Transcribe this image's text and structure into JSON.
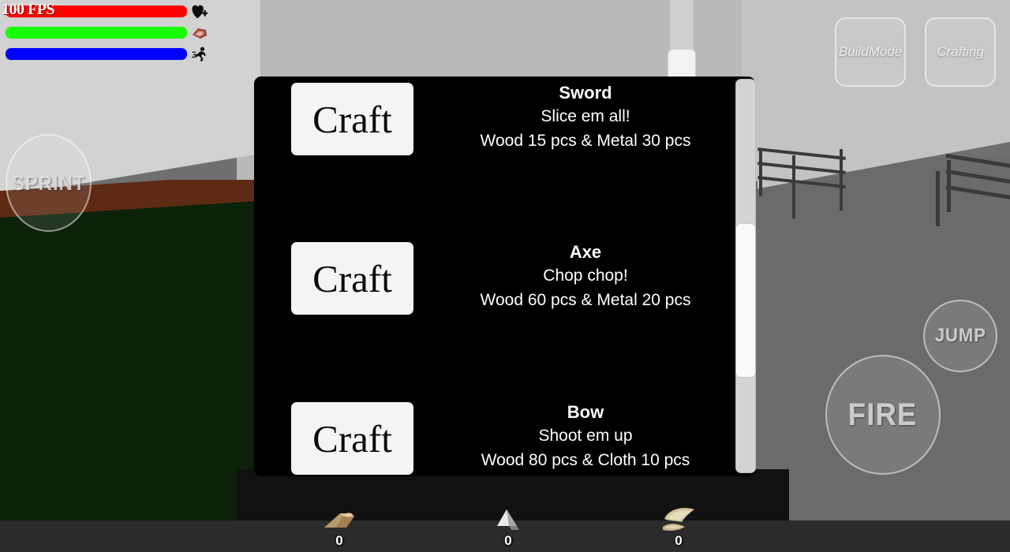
{
  "hud": {
    "fps_label": "100 FPS",
    "bars": [
      {
        "name": "health",
        "icon": "heart-plus-icon",
        "glyph": "♥",
        "color": "#ff0000",
        "fill_percent": 100,
        "track_color": "#c9c9c9"
      },
      {
        "name": "hunger",
        "icon": "meat-icon",
        "glyph": "🥩",
        "color": "#1aff00",
        "fill_percent": 100,
        "track_color": "#c9c9c9"
      },
      {
        "name": "stamina",
        "icon": "running-man-icon",
        "glyph": "🏃",
        "color": "#0000ff",
        "fill_percent": 100,
        "track_color": "#c9c9c9"
      }
    ]
  },
  "controls": {
    "sprint_label": "SPRINT",
    "fire_label": "FIRE",
    "jump_label": "JUMP",
    "buildmode_label": "BuildMode",
    "crafting_label": "Crafting"
  },
  "crafting_panel": {
    "background_color": "#000000",
    "recipes": [
      {
        "button_label": "Craft",
        "name": "Sword",
        "description": "Slice em all!",
        "cost": "Wood 15 pcs & Metal 30 pcs"
      },
      {
        "button_label": "Craft",
        "name": "Axe",
        "description": "Chop chop!",
        "cost": "Wood 60 pcs & Metal 20 pcs"
      },
      {
        "button_label": "Craft",
        "name": "Bow",
        "description": "Shoot em up",
        "cost": "Wood 80 pcs & Cloth 10 pcs"
      }
    ],
    "scrollbar": {
      "track_color": "#d4d4d4",
      "thumb_color": "#fafafa"
    }
  },
  "resources": [
    {
      "name": "wood",
      "icon": "wood-log-icon",
      "glyph": "🪵",
      "count": "0"
    },
    {
      "name": "metal",
      "icon": "metal-ore-icon",
      "glyph": "◢",
      "count": "0"
    },
    {
      "name": "cloth",
      "icon": "cloth-roll-icon",
      "glyph": "🧻",
      "count": "0"
    }
  ]
}
